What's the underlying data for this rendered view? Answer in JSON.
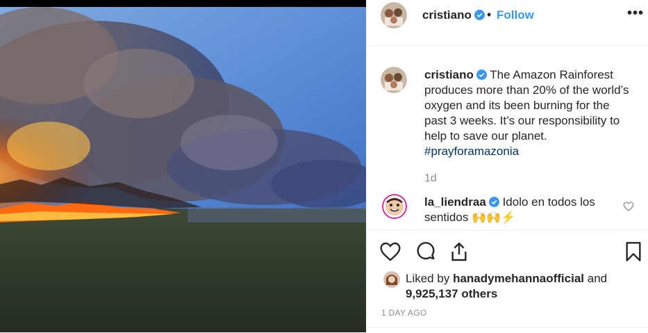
{
  "post": {
    "author": "cristiano",
    "follow_label": "Follow",
    "more_label": "•••",
    "dot": "•"
  },
  "caption": {
    "author": "cristiano",
    "text": "The Amazon Rainforest produces more than 20% of the world’s oxygen and its been burning for the past 3 weeks. It’s our responsibility to help to save our planet.",
    "hashtag": "#prayforamazonia",
    "time": "1d"
  },
  "comment": {
    "author": "la_liendraa",
    "text": "Idolo en todos los sentidos 🙌🙌⚡"
  },
  "likes": {
    "prefix": "Liked by",
    "liker": "hanadymehannaofficial",
    "and": "and",
    "others": "9,925,137 others"
  },
  "timestamp": "1 DAY AGO",
  "icons": {
    "verified": "verified-badge-icon",
    "like": "heart-icon",
    "comment": "comment-bubble-icon",
    "share": "share-icon",
    "save": "bookmark-icon"
  },
  "colors": {
    "link_blue": "#3897f0",
    "hashtag": "#003569",
    "muted": "#8e8e8e",
    "text": "#262626"
  }
}
